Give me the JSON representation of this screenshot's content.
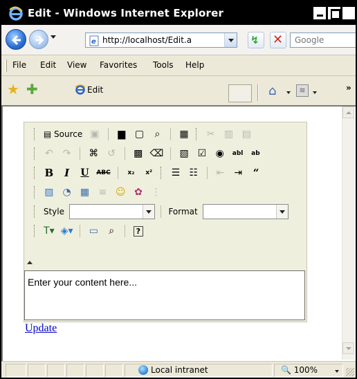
{
  "window": {
    "title": "Edit - Windows Internet Explorer"
  },
  "address_bar": {
    "url": "http://localhost/Edit.a",
    "search_placeholder": "Google"
  },
  "menu_bar": {
    "items": [
      "File",
      "Edit",
      "View",
      "Favorites",
      "Tools",
      "Help"
    ]
  },
  "favorites_bar": {
    "tab_label": "Edit",
    "overflow": "»"
  },
  "editor": {
    "toolbar_row1": {
      "source_label": "Source"
    },
    "toolbar_row5": {
      "style_label": "Style",
      "format_label": "Format",
      "style_value": "",
      "format_value": ""
    },
    "content_text": "Enter your content here..."
  },
  "page": {
    "update_link": "Update"
  },
  "status_bar": {
    "zone": "Local intranet",
    "zoom": "100%"
  },
  "colors": {
    "title_bg": "#000000",
    "chrome_bg": "#ece9d8",
    "editor_bg": "#efefde",
    "link": "#0000cc"
  },
  "icons": {
    "title": "ie-logo-icon",
    "back": "back-arrow-icon",
    "forward": "forward-arrow-icon",
    "refresh": "refresh-icon",
    "stop": "stop-icon",
    "favorites": "star-icon",
    "add_favorites": "add-favorite-icon",
    "home": "home-icon",
    "feeds": "rss-icon",
    "zone": "globe-icon"
  }
}
